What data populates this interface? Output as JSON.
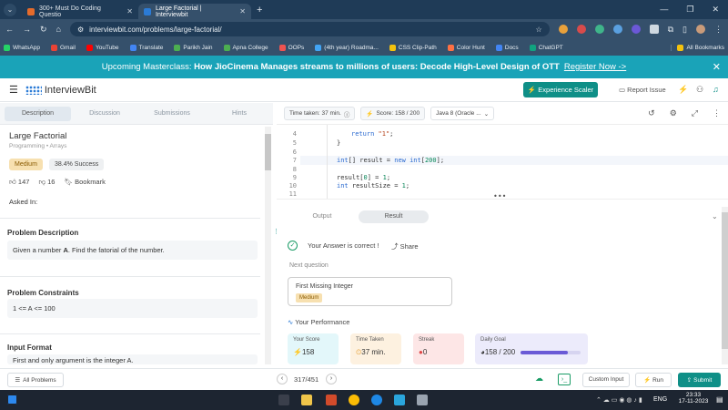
{
  "browser": {
    "tabs": [
      {
        "label": "300+ Must Do Coding Questio",
        "active": false
      },
      {
        "label": "Large Factorial | Interviewbit",
        "active": true
      }
    ],
    "url": "interviewbit.com/problems/large-factorial/",
    "bookmarks": [
      "WhatsApp",
      "Gmail",
      "YouTube",
      "Translate",
      "Parikh Jain",
      "Apna College",
      "OOPs",
      "(4th year) Roadma...",
      "CSS Clip-Path",
      "Color Hunt",
      "Docs",
      "ChatGPT"
    ],
    "all_bookmarks": "All Bookmarks"
  },
  "banner": {
    "prefix": "Upcoming Masterclass:",
    "bold": "How JioCinema Manages streams to millions of users: Decode High-Level Design of OTT",
    "link": "Register Now ->"
  },
  "header": {
    "logo": "InterviewBit",
    "experience_button": "Experience Scaler",
    "report_issue": "Report Issue"
  },
  "left": {
    "tabs": [
      "Description",
      "Discussion",
      "Submissions",
      "Hints"
    ],
    "title": "Large Factorial",
    "breadcrumb": "Programming • Arrays",
    "difficulty": "Medium",
    "success": "38.4% Success",
    "likes": "147",
    "dislikes": "16",
    "bookmark": "Bookmark",
    "asked_in": "Asked In:",
    "problem_description_h": "Problem Description",
    "problem_description_pre": "Given a number ",
    "problem_description_bold": "A",
    "problem_description_post": ". Find the fatorial of the number.",
    "constraints_h": "Problem Constraints",
    "constraints": "1 <= A <= 100",
    "input_format_h": "Input Format",
    "input_format": "First and only argument is the integer A."
  },
  "right": {
    "time_taken": "Time taken: 37 min.",
    "score": "Score: 158 / 200",
    "language": "Java 8 (Oracle ...",
    "code_lines": [
      {
        "n": "4",
        "text": "return \"1\";"
      },
      {
        "n": "5",
        "text": "}"
      },
      {
        "n": "6",
        "text": ""
      },
      {
        "n": "7",
        "text": "int[] result = new int[200];"
      },
      {
        "n": "8",
        "text": ""
      },
      {
        "n": "9",
        "text": "result[0] = 1;"
      },
      {
        "n": "10",
        "text": "int resultSize = 1;"
      },
      {
        "n": "11",
        "text": ""
      }
    ],
    "output_tab": "Output",
    "result_tab": "Result",
    "answer_correct": "Your Answer is correct !",
    "share": "Share",
    "next_question": "Next question",
    "next_title": "First Missing Integer",
    "next_difficulty": "Medium",
    "your_performance": "Your Performance",
    "your_score_label": "Your Score",
    "your_score": "158",
    "time_taken_label": "Time Taken",
    "time_taken_value": "37 min.",
    "streak_label": "Streak",
    "streak_value": "0",
    "daily_goal_label": "Daily Goal",
    "daily_goal_value": "158 / 200",
    "daily_goal_progress": 0.79
  },
  "bottom": {
    "all_problems": "All Problems",
    "pager": "317/451",
    "custom_input": "Custom Input",
    "run": "Run",
    "submit": "Submit"
  },
  "taskbar": {
    "lang": "ENG",
    "time": "23:33",
    "date": "17-11-2023"
  },
  "colors": {
    "banner": "#1aa3b8",
    "accent": "#0f8f87",
    "medium_badge": "#f7e0b0"
  }
}
